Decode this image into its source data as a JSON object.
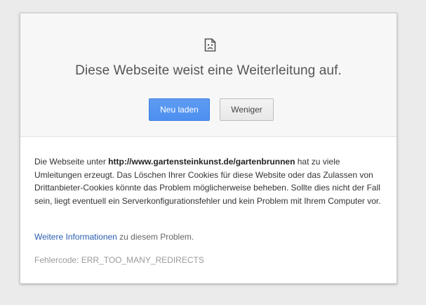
{
  "title": "Diese Webseite weist eine Weiterleitung auf.",
  "icon": "sad-page-icon",
  "buttons": {
    "reload_label": "Neu laden",
    "less_label": "Weniger"
  },
  "description": {
    "prefix": "Die Webseite unter ",
    "url": "http://www.gartensteinkunst.de/gartenbrunnen",
    "suffix": " hat zu viele Umleitungen erzeugt. Das Löschen Ihrer Cookies für diese Website oder das Zulassen von Drittanbieter-Cookies könnte das Problem möglicherweise beheben. Sollte dies nicht der Fall sein, liegt eventuell ein Serverkonfigurationsfehler und kein Problem mit Ihrem Computer vor."
  },
  "more_info": {
    "link_text": "Weitere Informationen",
    "rest_text": " zu diesem Problem."
  },
  "error_code": "Fehlercode: ERR_TOO_MANY_REDIRECTS",
  "colors": {
    "primary_button": "#4d8ff0",
    "link": "#2a5db0",
    "background": "#ebebeb"
  }
}
